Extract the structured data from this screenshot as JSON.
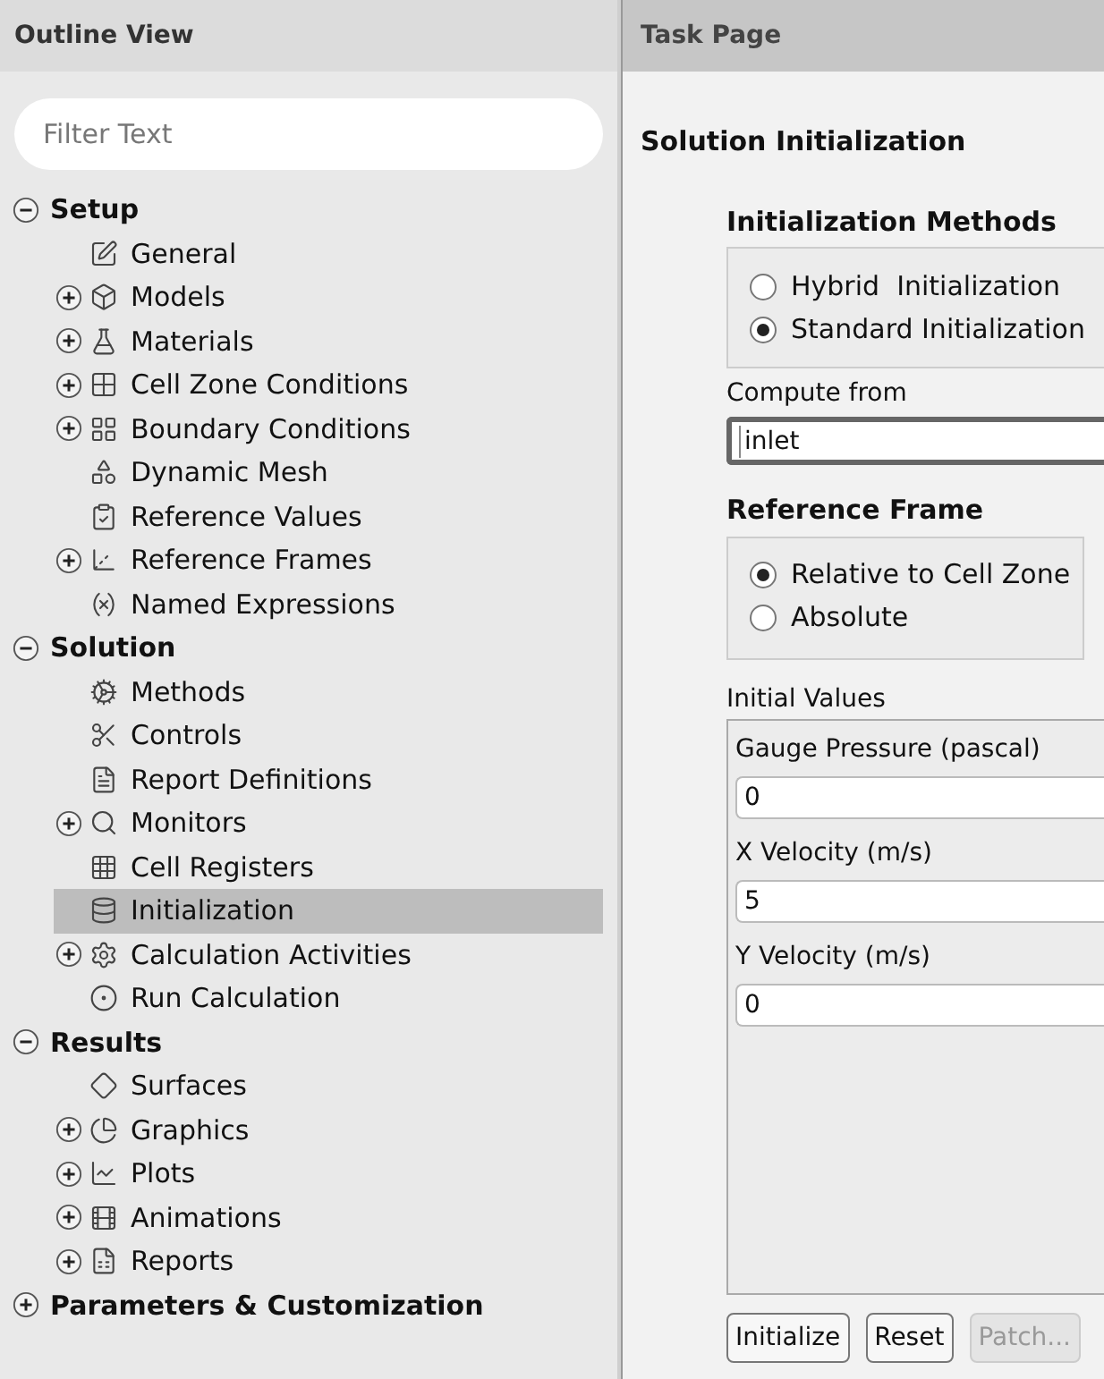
{
  "outline": {
    "title": "Outline View",
    "filter": {
      "placeholder": "Filter Text"
    },
    "sections": [
      {
        "label": "Setup",
        "expanded": true,
        "children": [
          {
            "label": "General",
            "kind": "leaf",
            "selected": false
          },
          {
            "label": "Models",
            "kind": "group",
            "expanded": false,
            "selected": false
          },
          {
            "label": "Materials",
            "kind": "group",
            "expanded": false,
            "selected": false
          },
          {
            "label": "Cell Zone Conditions",
            "kind": "group",
            "expanded": false,
            "selected": false
          },
          {
            "label": "Boundary Conditions",
            "kind": "group",
            "expanded": false,
            "selected": false
          },
          {
            "label": "Dynamic Mesh",
            "kind": "leaf",
            "selected": false
          },
          {
            "label": "Reference Values",
            "kind": "leaf",
            "selected": false
          },
          {
            "label": "Reference Frames",
            "kind": "group",
            "expanded": false,
            "selected": false
          },
          {
            "label": "Named Expressions",
            "kind": "leaf",
            "selected": false
          }
        ]
      },
      {
        "label": "Solution",
        "expanded": true,
        "children": [
          {
            "label": "Methods",
            "kind": "leaf",
            "selected": false
          },
          {
            "label": "Controls",
            "kind": "leaf",
            "selected": false
          },
          {
            "label": "Report Definitions",
            "kind": "leaf",
            "selected": false
          },
          {
            "label": "Monitors",
            "kind": "group",
            "expanded": false,
            "selected": false
          },
          {
            "label": "Cell Registers",
            "kind": "leaf",
            "selected": false
          },
          {
            "label": "Initialization",
            "kind": "leaf",
            "selected": true
          },
          {
            "label": "Calculation Activities",
            "kind": "group",
            "expanded": false,
            "selected": false
          },
          {
            "label": "Run Calculation",
            "kind": "leaf",
            "selected": false
          }
        ]
      },
      {
        "label": "Results",
        "expanded": true,
        "children": [
          {
            "label": "Surfaces",
            "kind": "leaf",
            "selected": false
          },
          {
            "label": "Graphics",
            "kind": "group",
            "expanded": false,
            "selected": false
          },
          {
            "label": "Plots",
            "kind": "group",
            "expanded": false,
            "selected": false
          },
          {
            "label": "Animations",
            "kind": "group",
            "expanded": false,
            "selected": false
          },
          {
            "label": "Reports",
            "kind": "group",
            "expanded": false,
            "selected": false
          }
        ]
      },
      {
        "label": "Parameters & Customization",
        "expanded": false
      }
    ]
  },
  "task_page": {
    "title": "Task Page",
    "heading": "Solution Initialization",
    "initialization_methods": {
      "title": "Initialization Methods",
      "options": [
        {
          "label": "Hybrid  Initialization",
          "selected": false
        },
        {
          "label": "Standard Initialization",
          "selected": true
        }
      ]
    },
    "compute_from": {
      "label": "Compute from",
      "value": "inlet"
    },
    "reference_frame": {
      "title": "Reference Frame",
      "options": [
        {
          "label": "Relative to Cell Zone",
          "selected": true
        },
        {
          "label": "Absolute",
          "selected": false
        }
      ]
    },
    "initial_values": {
      "title": "Initial Values",
      "fields": [
        {
          "label": "Gauge Pressure (pascal)",
          "value": "0"
        },
        {
          "label": "X Velocity (m/s)",
          "value": "5"
        },
        {
          "label": "Y Velocity (m/s)",
          "value": "0"
        }
      ]
    },
    "buttons": [
      {
        "label": "Initialize",
        "disabled": false
      },
      {
        "label": "Reset",
        "disabled": false
      },
      {
        "label": "Patch...",
        "disabled": true
      }
    ]
  }
}
